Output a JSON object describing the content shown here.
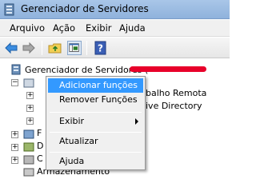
{
  "window": {
    "title": "Gerenciador de Servidores"
  },
  "menubar": {
    "items": [
      "Arquivo",
      "Ação",
      "Exibir",
      "Ajuda"
    ]
  },
  "toolbar": {
    "buttons": [
      "back-arrow-icon",
      "forward-arrow-icon",
      "folder-up-icon",
      "console-tree-icon",
      "help-icon"
    ],
    "help_glyph": "?"
  },
  "tree": {
    "root_label": "Gerenciador de Servidores (",
    "partial_right_1": "balho Remota",
    "partial_right_2": "ive Directory",
    "partial_left_storage": "Armazenamento",
    "partial_left_1": "F",
    "partial_left_2": "D",
    "partial_left_3": "C"
  },
  "context_menu": {
    "items": {
      "add_roles": "Adicionar funções",
      "remove_roles": "Remover Funções",
      "view": "Exibir",
      "refresh": "Atualizar",
      "help": "Ajuda"
    },
    "highlight_color": "#3399ff"
  },
  "colors": {
    "redaction": "#e8002a",
    "titlebar": "#a9c6e8"
  }
}
